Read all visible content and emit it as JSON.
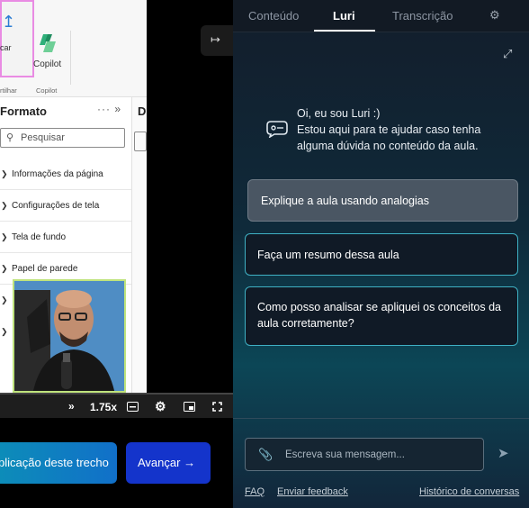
{
  "ribbon": {
    "share_label": "car",
    "share_group": "rtilhar",
    "copilot_label": "Copilot",
    "copilot_group": "Copilot"
  },
  "format_pane": {
    "title": "Formato",
    "search_placeholder": "Pesquisar",
    "items": [
      {
        "label": "Informações da página"
      },
      {
        "label": "Configurações de tela"
      },
      {
        "label": "Tela de fundo"
      },
      {
        "label": "Papel de parede"
      }
    ],
    "side_title": "D"
  },
  "player": {
    "rate": "1.75x"
  },
  "bottom": {
    "apply_label": "plicação deste trecho",
    "next_label": "Avançar"
  },
  "tabs": [
    {
      "label": "Conteúdo"
    },
    {
      "label": "Luri"
    },
    {
      "label": "Transcrição"
    }
  ],
  "luri": {
    "greeting_line1": "Oi, eu sou Luri :)",
    "greeting_line2": "Estou aqui para te ajudar caso tenha alguma dúvida no conteúdo da aula.",
    "suggestions": [
      {
        "label": "Explique a aula usando analogias"
      },
      {
        "label": "Faça um resumo dessa aula"
      },
      {
        "label": "Como posso analisar se apliquei os conceitos da aula corretamente?"
      }
    ],
    "message_placeholder": "Escreva sua mensagem..."
  },
  "footer": {
    "faq": "FAQ",
    "feedback": "Enviar feedback",
    "history": "Histórico de conversas"
  },
  "colors": {
    "accent_blue": "#1434cb",
    "suggestion_border": "#3fb1c4",
    "selected_suggestion": "#4a5663"
  }
}
